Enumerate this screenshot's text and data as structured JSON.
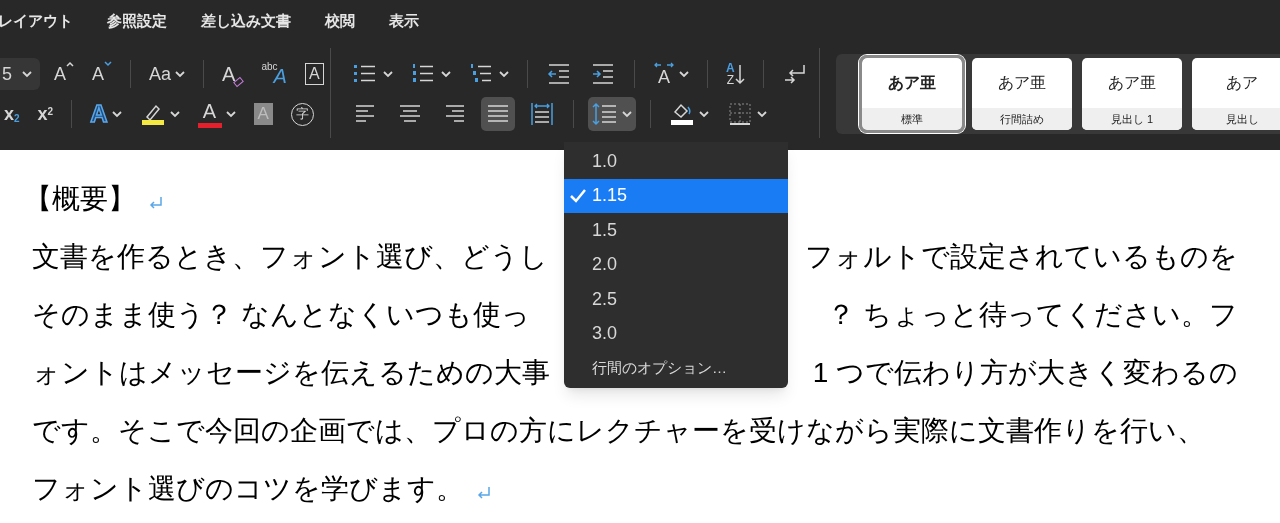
{
  "menu_bar": [
    {
      "label": "レイアウト"
    },
    {
      "label": "参照設定"
    },
    {
      "label": "差し込み文書"
    },
    {
      "label": "校閲"
    },
    {
      "label": "表示"
    }
  ],
  "font_rows": [
    [
      {
        "kind": "field",
        "value": "5"
      },
      {
        "kind": "grow",
        "label": "A",
        "dropdown": false,
        "pressed": false
      },
      {
        "kind": "shrink",
        "label": "A",
        "dropdown": false,
        "pressed": false
      },
      {
        "kind": "divider"
      },
      {
        "kind": "case",
        "label": "Aa",
        "dropdown": true,
        "pressed": false
      },
      {
        "kind": "divider"
      },
      {
        "kind": "clear",
        "label": "A",
        "dropdown": false,
        "pressed": false
      },
      {
        "kind": "phonetic",
        "small": "abc",
        "label": "A",
        "dropdown": false,
        "pressed": false
      },
      {
        "kind": "boxed",
        "label": "A",
        "dropdown": false,
        "pressed": false
      }
    ],
    [
      {
        "kind": "script",
        "label": "x$_{2}$",
        "dropdown": false,
        "pressed": false
      },
      {
        "kind": "script",
        "label": "x$^{2}$",
        "dropdown": false,
        "pressed": false
      },
      {
        "kind": "divider"
      },
      {
        "kind": "effects",
        "label": "A",
        "dropdown": true,
        "pressed": false
      },
      {
        "kind": "highlight",
        "color": "#f4e842",
        "dropdown": true,
        "pressed": false
      },
      {
        "kind": "fontcolor",
        "label": "A",
        "color": "#e3202b",
        "dropdown": true,
        "pressed": false
      },
      {
        "kind": "shade",
        "label": "A",
        "dropdown": false,
        "pressed": false
      },
      {
        "kind": "enclose",
        "label": "字",
        "dropdown": false,
        "pressed": false
      }
    ]
  ],
  "paragraph_rows": [
    [
      {
        "kind": "bullets",
        "dropdown": true,
        "pressed": false
      },
      {
        "kind": "numbering",
        "dropdown": true,
        "pressed": false
      },
      {
        "kind": "multilevel",
        "dropdown": true,
        "pressed": false
      },
      {
        "kind": "divider"
      },
      {
        "kind": "outdent",
        "dropdown": false,
        "pressed": false
      },
      {
        "kind": "indent",
        "dropdown": false,
        "pressed": false
      },
      {
        "kind": "divider"
      },
      {
        "kind": "direction",
        "label": "A",
        "dropdown": true,
        "pressed": false
      },
      {
        "kind": "divider"
      },
      {
        "kind": "sort",
        "label": "A",
        "small": "Z",
        "dropdown": false,
        "pressed": false
      },
      {
        "kind": "divider"
      },
      {
        "kind": "mark",
        "dropdown": false,
        "pressed": false
      }
    ],
    [
      {
        "kind": "left",
        "dropdown": false,
        "pressed": false
      },
      {
        "kind": "center",
        "dropdown": false,
        "pressed": false
      },
      {
        "kind": "right",
        "dropdown": false,
        "pressed": false
      },
      {
        "kind": "justify",
        "dropdown": false,
        "pressed": true
      },
      {
        "kind": "distributed",
        "dropdown": false,
        "pressed": false
      },
      {
        "kind": "divider"
      },
      {
        "kind": "spacing",
        "dropdown": true,
        "pressed": true
      },
      {
        "kind": "divider"
      },
      {
        "kind": "fill",
        "dropdown": true,
        "pressed": false
      },
      {
        "kind": "borders",
        "dropdown": true,
        "pressed": false
      }
    ]
  ],
  "styles": [
    {
      "preview": "あア亜",
      "name": "標準",
      "selected": true
    },
    {
      "preview": "あア亜",
      "name": "行間詰め",
      "selected": false
    },
    {
      "preview": "あア亜",
      "name": "見出し 1",
      "selected": false
    },
    {
      "preview": "あア",
      "name": "見出し",
      "selected": false
    }
  ],
  "line_spacing_menu": [
    {
      "label": "1.0",
      "selected": false,
      "kind": "value"
    },
    {
      "label": "1.15",
      "selected": true,
      "kind": "value"
    },
    {
      "label": "1.5",
      "selected": false,
      "kind": "value"
    },
    {
      "label": "2.0",
      "selected": false,
      "kind": "value"
    },
    {
      "label": "2.5",
      "selected": false,
      "kind": "value"
    },
    {
      "label": "3.0",
      "selected": false,
      "kind": "value"
    },
    {
      "label": "行間のオプション…",
      "selected": false,
      "kind": "option"
    }
  ],
  "document": {
    "heading": {
      "text": "【概要】",
      "end_mark": true
    },
    "lines": [
      {
        "left": "文書を作るとき、フォント選び、どうし",
        "right": "フォルトで設定されているものを",
        "end_mark": false
      },
      {
        "left": "そのまま使う？ なんとなくいつも使っ",
        "right": "？ ちょっと待ってください。フ",
        "end_mark": false
      },
      {
        "left": "ォントはメッセージを伝えるための大事",
        "right": "1 つで伝わり方が大きく変わるの",
        "end_mark": false
      },
      {
        "left": "です。そこで今回の企画では、プロの方にレクチャーを受けながら実際に文書作りを行い、",
        "end_mark": false
      },
      {
        "left": "フォント選びのコツを学びます。",
        "end_mark": true
      }
    ]
  }
}
